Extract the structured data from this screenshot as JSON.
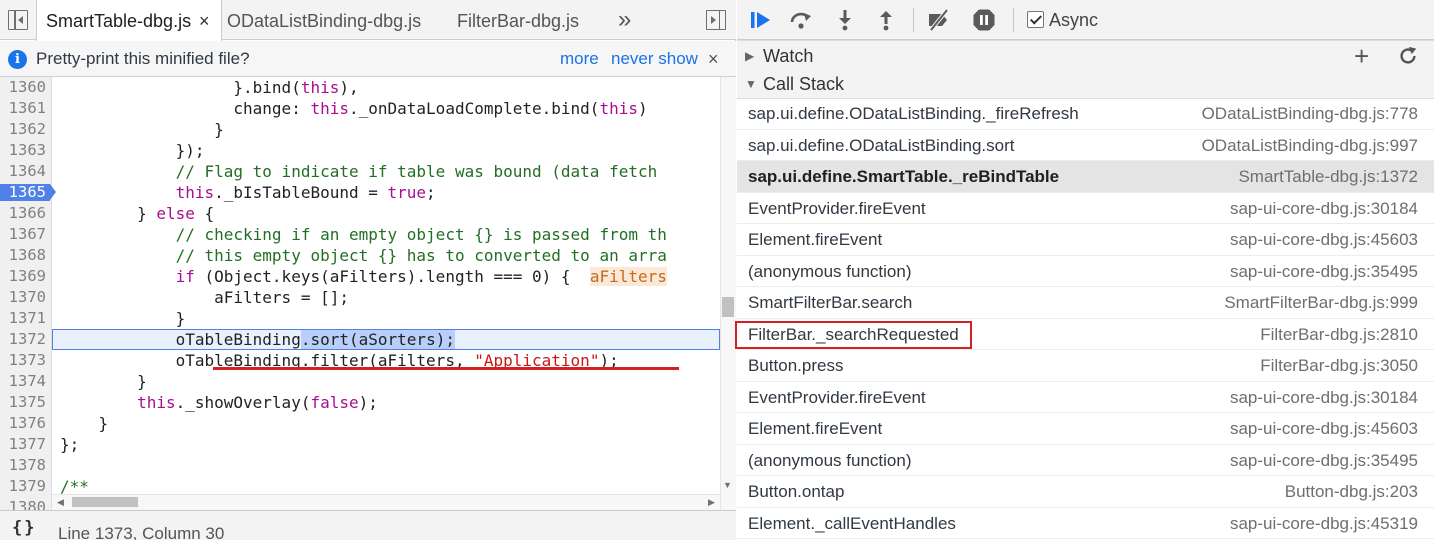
{
  "editor_tabs": [
    {
      "label": "SmartTable-dbg.js",
      "active": true,
      "close": "×"
    },
    {
      "label": "ODataListBinding-dbg.js",
      "active": false
    },
    {
      "label": "FilterBar-dbg.js",
      "active": false
    }
  ],
  "tabs_overflow": "»",
  "infobar": {
    "text": "Pretty-print this minified file?",
    "more": "more",
    "never_show": "never show",
    "close": "×",
    "icon": "info-icon"
  },
  "code_lines": [
    {
      "n": "1360",
      "t": "                  }.bind(this),"
    },
    {
      "n": "1361",
      "t": "                  change: this._onDataLoadComplete.bind(this)"
    },
    {
      "n": "1362",
      "t": "                }"
    },
    {
      "n": "1363",
      "t": "            });"
    },
    {
      "n": "1364",
      "t": "            // Flag to indicate if table was bound (data fetch"
    },
    {
      "n": "1365",
      "t": "            this._bIsTableBound = true;"
    },
    {
      "n": "1366",
      "t": "        } else {"
    },
    {
      "n": "1367",
      "t": "            // checking if an empty object {} is passed from th"
    },
    {
      "n": "1368",
      "t": "            // this empty object {} has to converted to an arra"
    },
    {
      "n": "1369",
      "t": "            if (Object.keys(aFilters).length === 0) {  aFilters"
    },
    {
      "n": "1370",
      "t": "                aFilters = [];"
    },
    {
      "n": "1371",
      "t": "            }"
    },
    {
      "n": "1372",
      "t": "            oTableBinding.sort(aSorters);"
    },
    {
      "n": "1373",
      "t": "            oTableBinding.filter(aFilters, \"Application\");"
    },
    {
      "n": "1374",
      "t": "        }"
    },
    {
      "n": "1375",
      "t": "        this._showOverlay(false);"
    },
    {
      "n": "1376",
      "t": "    }"
    },
    {
      "n": "1377",
      "t": "};"
    },
    {
      "n": "1378",
      "t": ""
    },
    {
      "n": "1379",
      "t": "/**"
    },
    {
      "n": "1380",
      "t": ""
    }
  ],
  "breakpoint_line": "1365",
  "execution_line": "1372",
  "statusbar": {
    "format_icon": "{}",
    "cursor": "Line 1373, Column 30"
  },
  "debugger_toolbar": {
    "icons": [
      "resume-icon",
      "step-over-icon",
      "step-into-icon",
      "step-out-icon",
      "deactivate-breakpoints-icon",
      "pause-on-exceptions-icon"
    ],
    "async_label": "Async",
    "async_checked": true
  },
  "watch": {
    "label": "Watch",
    "add": "+",
    "refresh_icon": "refresh-icon"
  },
  "call_stack": {
    "label": "Call Stack",
    "frames": [
      {
        "fn": "sap.ui.define.ODataListBinding._fireRefresh",
        "loc": "ODataListBinding-dbg.js:778"
      },
      {
        "fn": "sap.ui.define.ODataListBinding.sort",
        "loc": "ODataListBinding-dbg.js:997"
      },
      {
        "fn": "sap.ui.define.SmartTable._reBindTable",
        "loc": "SmartTable-dbg.js:1372"
      },
      {
        "fn": "EventProvider.fireEvent",
        "loc": "sap-ui-core-dbg.js:30184"
      },
      {
        "fn": "Element.fireEvent",
        "loc": "sap-ui-core-dbg.js:45603"
      },
      {
        "fn": "(anonymous function)",
        "loc": "sap-ui-core-dbg.js:35495"
      },
      {
        "fn": "SmartFilterBar.search",
        "loc": "SmartFilterBar-dbg.js:999"
      },
      {
        "fn": "FilterBar._searchRequested",
        "loc": "FilterBar-dbg.js:2810"
      },
      {
        "fn": "Button.press",
        "loc": "FilterBar-dbg.js:3050"
      },
      {
        "fn": "EventProvider.fireEvent",
        "loc": "sap-ui-core-dbg.js:30184"
      },
      {
        "fn": "Element.fireEvent",
        "loc": "sap-ui-core-dbg.js:45603"
      },
      {
        "fn": "(anonymous function)",
        "loc": "sap-ui-core-dbg.js:35495"
      },
      {
        "fn": "Button.ontap",
        "loc": "Button-dbg.js:203"
      },
      {
        "fn": "Element._callEventHandles",
        "loc": "sap-ui-core-dbg.js:45319"
      }
    ],
    "selected_index": 2,
    "highlighted_index": 7
  },
  "colors": {
    "accent": "#1a73e8",
    "breakpoint": "#4f81e8",
    "annotation_red": "#d42020",
    "keyword": "#aa0d91",
    "comment": "#236e25",
    "string": "#c41a16"
  }
}
